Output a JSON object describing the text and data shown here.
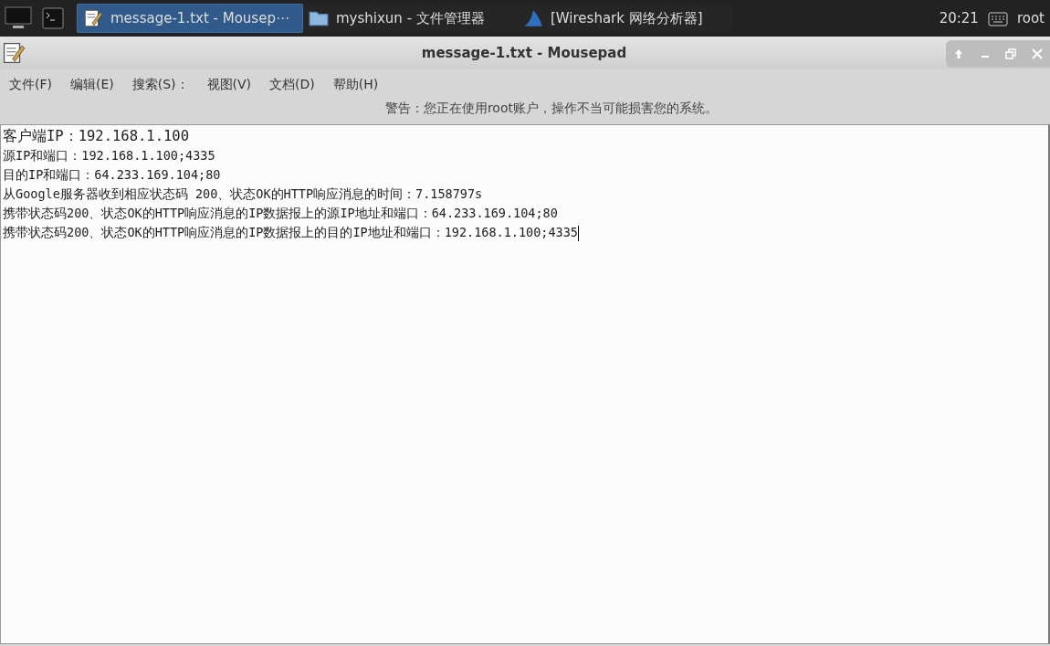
{
  "taskbar": {
    "tasks": [
      {
        "label": "message-1.txt - Mousep⋯",
        "kind": "editor",
        "selected": true
      },
      {
        "label": "myshixun - 文件管理器",
        "kind": "folder",
        "selected": false
      },
      {
        "label": "[Wireshark 网络分析器]",
        "kind": "shark",
        "selected": false
      }
    ],
    "clock": "20:21",
    "user": "root"
  },
  "window": {
    "title": "message-1.txt - Mousepad"
  },
  "menu": [
    "文件(F)",
    "编辑(E)",
    "搜索(S)：",
    "视图(V)",
    "文档(D)",
    "帮助(H)"
  ],
  "warning": "警告：您正在使用root账户，操作不当可能损害您的系统。",
  "editor": {
    "lines": [
      "客户端IP：192.168.1.100",
      "源IP和端口：192.168.1.100;4335",
      "目的IP和端口：64.233.169.104;80",
      "从Google服务器收到相应状态码 200、状态OK的HTTP响应消息的时间：7.158797s",
      "携带状态码200、状态OK的HTTP响应消息的IP数据报上的源IP地址和端口：64.233.169.104;80",
      "携带状态码200、状态OK的HTTP响应消息的IP数据报上的目的IP地址和端口：192.168.1.100;4335"
    ]
  }
}
